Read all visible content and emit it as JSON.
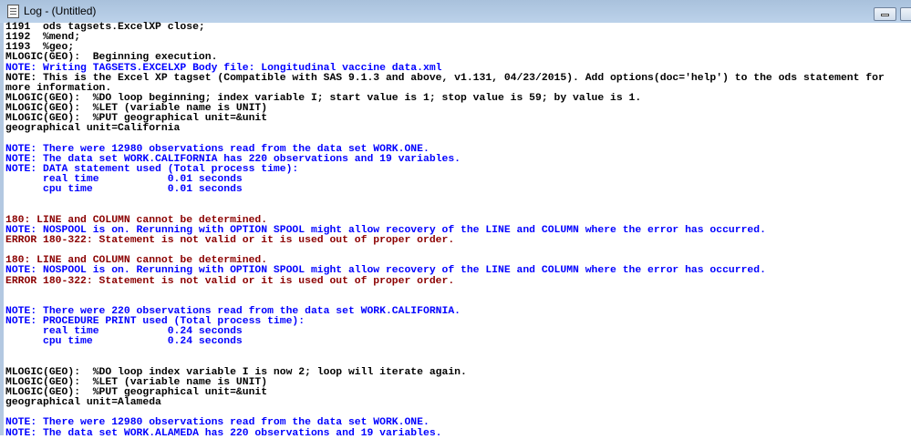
{
  "window": {
    "title": "Log - (Untitled)"
  },
  "colors": {
    "note": "#0000ff",
    "error": "#8b0000",
    "normal": "#000000"
  },
  "log_lines": [
    {
      "text": "1191  ods tagsets.ExcelXP close;",
      "type": "normal"
    },
    {
      "text": "1192  %mend;",
      "type": "normal"
    },
    {
      "text": "1193  %geo;",
      "type": "normal"
    },
    {
      "text": "MLOGIC(GEO):  Beginning execution.",
      "type": "normal"
    },
    {
      "text": "NOTE: Writing TAGSETS.EXCELXP Body file: Longitudinal vaccine data.xml",
      "type": "note"
    },
    {
      "text": "NOTE: This is the Excel XP tagset (Compatible with SAS 9.1.3 and above, v1.131, 04/23/2015). Add options(doc='help') to the ods statement for",
      "type": "normal"
    },
    {
      "text": "more information.",
      "type": "normal"
    },
    {
      "text": "MLOGIC(GEO):  %DO loop beginning; index variable I; start value is 1; stop value is 59; by value is 1.",
      "type": "normal"
    },
    {
      "text": "MLOGIC(GEO):  %LET (variable name is UNIT)",
      "type": "normal"
    },
    {
      "text": "MLOGIC(GEO):  %PUT geographical unit=&unit",
      "type": "normal"
    },
    {
      "text": "geographical unit=California",
      "type": "normal"
    },
    {
      "text": "",
      "type": "normal"
    },
    {
      "text": "NOTE: There were 12980 observations read from the data set WORK.ONE.",
      "type": "note"
    },
    {
      "text": "NOTE: The data set WORK.CALIFORNIA has 220 observations and 19 variables.",
      "type": "note"
    },
    {
      "text": "NOTE: DATA statement used (Total process time):",
      "type": "note"
    },
    {
      "text": "      real time           0.01 seconds",
      "type": "note"
    },
    {
      "text": "      cpu time            0.01 seconds",
      "type": "note"
    },
    {
      "text": "",
      "type": "normal"
    },
    {
      "text": "",
      "type": "normal"
    },
    {
      "text": "180: LINE and COLUMN cannot be determined.",
      "type": "error"
    },
    {
      "text": "NOTE: NOSPOOL is on. Rerunning with OPTION SPOOL might allow recovery of the LINE and COLUMN where the error has occurred.",
      "type": "note"
    },
    {
      "text": "ERROR 180-322: Statement is not valid or it is used out of proper order.",
      "type": "error"
    },
    {
      "text": "",
      "type": "normal"
    },
    {
      "text": "180: LINE and COLUMN cannot be determined.",
      "type": "error"
    },
    {
      "text": "NOTE: NOSPOOL is on. Rerunning with OPTION SPOOL might allow recovery of the LINE and COLUMN where the error has occurred.",
      "type": "note"
    },
    {
      "text": "ERROR 180-322: Statement is not valid or it is used out of proper order.",
      "type": "error"
    },
    {
      "text": "",
      "type": "normal"
    },
    {
      "text": "",
      "type": "normal"
    },
    {
      "text": "NOTE: There were 220 observations read from the data set WORK.CALIFORNIA.",
      "type": "note"
    },
    {
      "text": "NOTE: PROCEDURE PRINT used (Total process time):",
      "type": "note"
    },
    {
      "text": "      real time           0.24 seconds",
      "type": "note"
    },
    {
      "text": "      cpu time            0.24 seconds",
      "type": "note"
    },
    {
      "text": "",
      "type": "normal"
    },
    {
      "text": "",
      "type": "normal"
    },
    {
      "text": "MLOGIC(GEO):  %DO loop index variable I is now 2; loop will iterate again.",
      "type": "normal"
    },
    {
      "text": "MLOGIC(GEO):  %LET (variable name is UNIT)",
      "type": "normal"
    },
    {
      "text": "MLOGIC(GEO):  %PUT geographical unit=&unit",
      "type": "normal"
    },
    {
      "text": "geographical unit=Alameda",
      "type": "normal"
    },
    {
      "text": "",
      "type": "normal"
    },
    {
      "text": "NOTE: There were 12980 observations read from the data set WORK.ONE.",
      "type": "note"
    },
    {
      "text": "NOTE: The data set WORK.ALAMEDA has 220 observations and 19 variables.",
      "type": "note"
    }
  ]
}
